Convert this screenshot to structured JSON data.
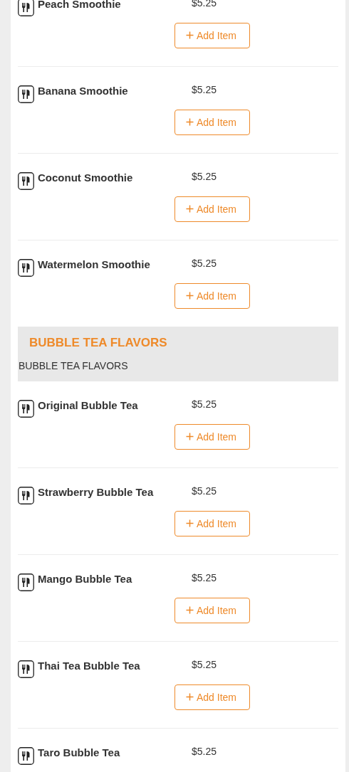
{
  "menu": [
    {
      "items": [
        {
          "name": "Peach Smoothie",
          "price": "$5.25",
          "button": "Add Item"
        },
        {
          "name": "Banana Smoothie",
          "price": "$5.25",
          "button": "Add Item"
        },
        {
          "name": "Coconut Smoothie",
          "price": "$5.25",
          "button": "Add Item"
        },
        {
          "name": "Watermelon Smoothie",
          "price": "$5.25",
          "button": "Add Item"
        }
      ]
    },
    {
      "title": "BUBBLE TEA FLAVORS",
      "subtitle": "BUBBLE TEA FLAVORS",
      "items": [
        {
          "name": "Original Bubble Tea",
          "price": "$5.25",
          "button": "Add Item"
        },
        {
          "name": "Strawberry Bubble Tea",
          "price": "$5.25",
          "button": "Add Item"
        },
        {
          "name": "Mango Bubble Tea",
          "price": "$5.25",
          "button": "Add Item"
        },
        {
          "name": "Thai Tea Bubble Tea",
          "price": "$5.25",
          "button": "Add Item"
        },
        {
          "name": "Taro Bubble Tea",
          "price": "$5.25"
        }
      ]
    }
  ]
}
